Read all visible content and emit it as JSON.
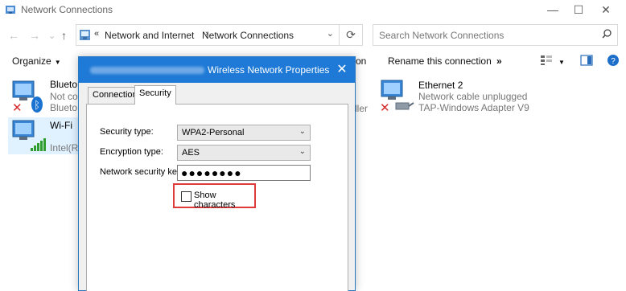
{
  "window": {
    "title": "Network Connections",
    "controls": {
      "minimize": "—",
      "maximize": "☐",
      "close": "✕"
    }
  },
  "address_bar": {
    "breadcrumb": [
      "Network and Internet",
      "Network Connections"
    ],
    "search_placeholder": "Search Network Connections"
  },
  "toolbar": {
    "organize": "Organize",
    "partial_item": "tion",
    "rename": "Rename this connection",
    "more": "»"
  },
  "connections": [
    {
      "name": "Blueto",
      "status": "Not co",
      "adapter": "Blueto"
    },
    {
      "name": "Wi-Fi",
      "status": "",
      "adapter": "Intel(R)"
    },
    {
      "name": "Ethernet 2",
      "status": "Network cable unplugged",
      "adapter": "TAP-Windows Adapter V9"
    }
  ],
  "partial_text_ller": "ller",
  "dialog": {
    "title": "Wireless Network Properties",
    "tabs": [
      "Connection",
      "Security"
    ],
    "active_tab": "Security",
    "fields": {
      "security_type_label": "Security type:",
      "security_type_value": "WPA2-Personal",
      "encryption_type_label": "Encryption type:",
      "encryption_type_value": "AES",
      "key_label": "Network security key",
      "key_value": "●●●●●●●●"
    },
    "show_characters_label": "Show characters"
  },
  "colors": {
    "dialog_title_bg": "#1e7ad6",
    "highlight_border": "#e03b3b",
    "selection_bg": "#cce8ff"
  }
}
